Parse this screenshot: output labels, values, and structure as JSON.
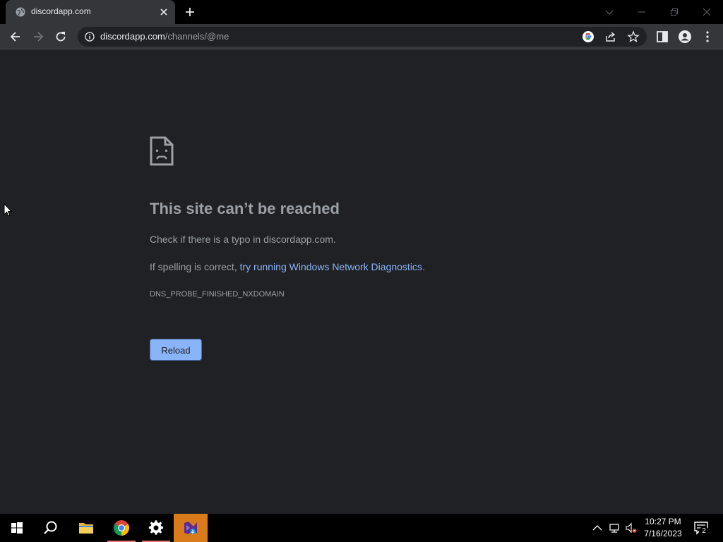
{
  "browser": {
    "tab": {
      "title": "discordapp.com"
    },
    "omnibox": {
      "host": "discordapp.com",
      "path": "/channels/@me"
    }
  },
  "error_page": {
    "title": "This site can’t be reached",
    "line1": "Check if there is a typo in discordapp.com.",
    "line2_prefix": "If spelling is correct, ",
    "line2_link": "try running Windows Network Diagnostics",
    "line2_suffix": ".",
    "error_code": "DNS_PROBE_FINISHED_NXDOMAIN",
    "reload_label": "Reload"
  },
  "taskbar": {
    "clock_time": "10:27 PM",
    "clock_date": "7/16/2023",
    "notification_count": "2"
  },
  "colors": {
    "page_bg": "#202124",
    "toolbar_bg": "#35363a",
    "link": "#8ab4f8",
    "text_secondary": "#9aa0a6"
  }
}
